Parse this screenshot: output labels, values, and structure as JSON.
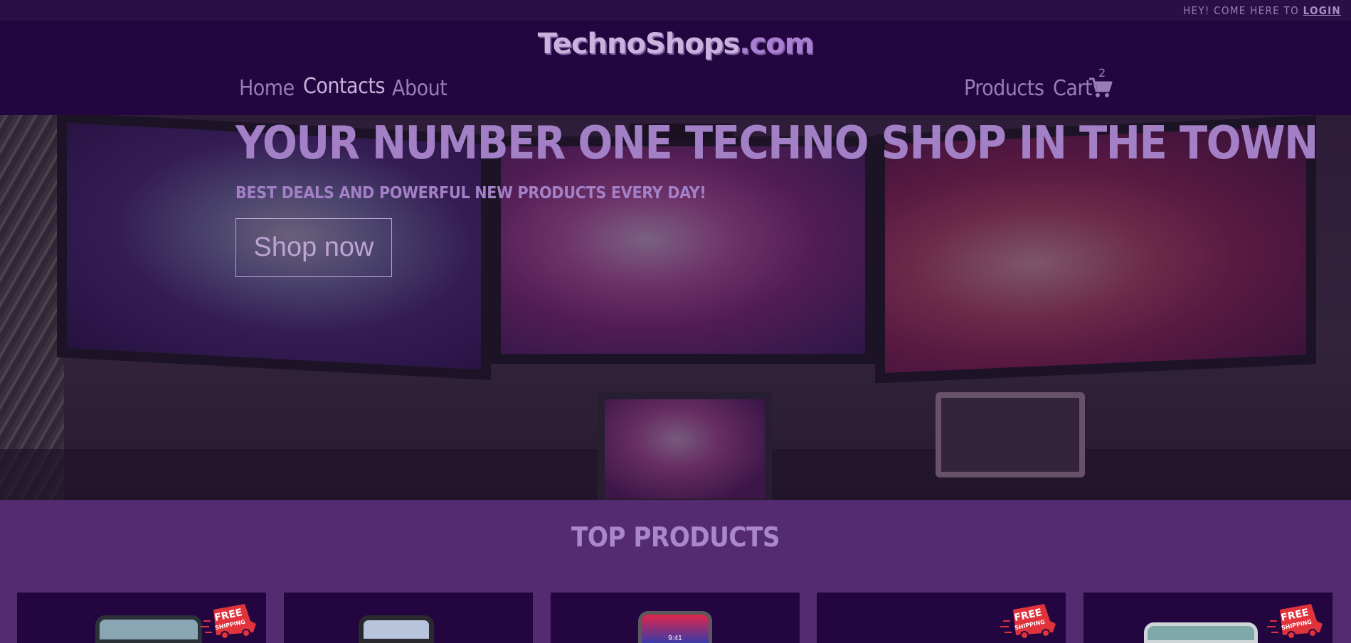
{
  "topbar": {
    "text": "HEY! COME HERE TO ",
    "login_label": "LOGIN"
  },
  "header": {
    "logo_main": "TechnoShops",
    "logo_suffix": ".com",
    "nav_left": [
      {
        "label": "Home"
      },
      {
        "label": "Contacts"
      },
      {
        "label": "About"
      }
    ],
    "nav_right": [
      {
        "label": "Products"
      },
      {
        "label": "Cart"
      }
    ],
    "cart_count": "2",
    "active_item": "Contacts"
  },
  "hero": {
    "title": "YOUR NUMBER ONE TECHNO SHOP IN THE TOWN",
    "subtitle": "BEST DEALS AND POWERFUL NEW PRODUCTS EVERY DAY!",
    "button_label": "Shop now"
  },
  "products": {
    "title": "TOP PRODUCTS",
    "cards": [
      {
        "free_shipping": true
      },
      {
        "free_shipping": false
      },
      {
        "free_shipping": false
      },
      {
        "free_shipping": true
      },
      {
        "free_shipping": true
      }
    ],
    "badge_line1": "FREE",
    "badge_line2": "SHIPPING",
    "phone_time": "9:41"
  },
  "colors": {
    "topbar_bg": "#2a0e45",
    "header_bg": "#230540",
    "section_bg": "#542a70",
    "accent_text": "#a380c6",
    "badge_red": "#e0333c"
  },
  "icons": {
    "cart": "shopping-cart-icon",
    "badge": "free-shipping-truck-icon"
  }
}
